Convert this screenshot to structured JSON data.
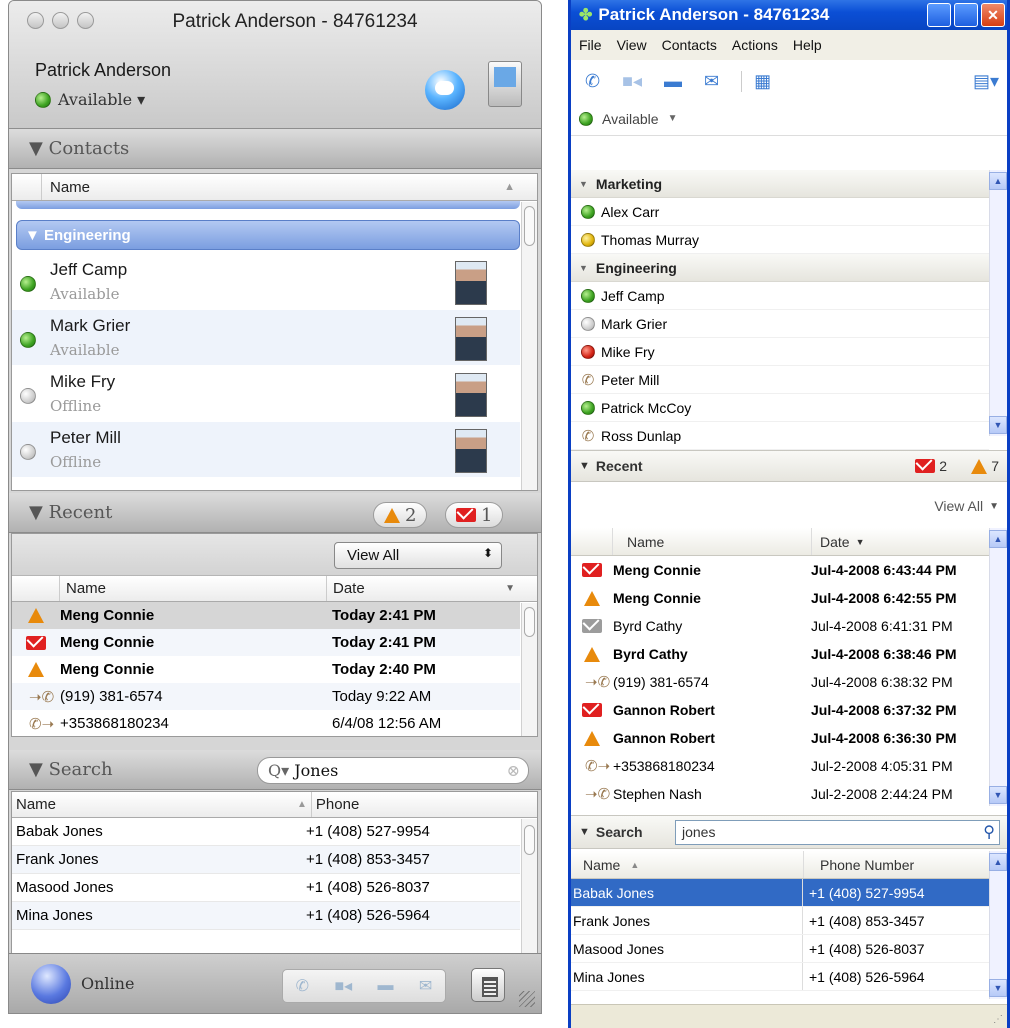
{
  "mac": {
    "title": "Patrick Anderson - 84761234",
    "user": "Patrick Anderson",
    "status": "Available ▾",
    "contacts_header": "▼ Contacts",
    "name_col": "Name",
    "group": "▼ Engineering",
    "contacts": [
      {
        "name": "Jeff Camp",
        "status": "Available",
        "presence": "green"
      },
      {
        "name": "Mark Grier",
        "status": "Available",
        "presence": "green"
      },
      {
        "name": "Mike Fry",
        "status": "Offline",
        "presence": "offline"
      },
      {
        "name": "Peter Mill",
        "status": "Offline",
        "presence": "offline"
      }
    ],
    "recent_header": "▼ Recent",
    "alert_count": "2",
    "msg_count": "1",
    "view_all": "View All",
    "recent_cols": {
      "name": "Name",
      "date": "Date"
    },
    "recent": [
      {
        "icon": "warning-icon",
        "name": "Meng Connie",
        "date": "Today 2:41 PM",
        "bold": true,
        "selected": true
      },
      {
        "icon": "voicemail-icon",
        "name": "Meng Connie",
        "date": "Today 2:41 PM",
        "bold": true
      },
      {
        "icon": "warning-icon",
        "name": "Meng Connie",
        "date": "Today 2:40 PM",
        "bold": true
      },
      {
        "icon": "incoming-call-icon",
        "name": "(919) 381-6574",
        "date": "Today 9:22 AM",
        "bold": false
      },
      {
        "icon": "outgoing-call-icon",
        "name": "+353868180234",
        "date": "6/4/08 12:56 AM",
        "bold": false
      }
    ],
    "search_header": "▼ Search",
    "search_value": "Jones",
    "search_cols": {
      "name": "Name",
      "phone": "Phone"
    },
    "search_results": [
      {
        "name": "Babak Jones",
        "phone": "+1 (408) 527-9954"
      },
      {
        "name": "Frank Jones",
        "phone": "+1 (408) 853-3457"
      },
      {
        "name": "Masood Jones",
        "phone": "+1 (408) 526-8037"
      },
      {
        "name": "Mina Jones",
        "phone": "+1 (408) 526-5964"
      }
    ],
    "online": "Online"
  },
  "xp": {
    "title": "Patrick Anderson - 84761234",
    "menu": [
      "File",
      "View",
      "Contacts",
      "Actions",
      "Help"
    ],
    "status": "Available",
    "groups": [
      {
        "name": "Marketing",
        "members": [
          {
            "name": "Alex Carr",
            "presence": "green"
          },
          {
            "name": "Thomas Murray",
            "presence": "yellow"
          }
        ]
      },
      {
        "name": "Engineering",
        "members": [
          {
            "name": "Jeff Camp",
            "presence": "green"
          },
          {
            "name": "Mark Grier",
            "presence": "offline"
          },
          {
            "name": "Mike Fry",
            "presence": "red"
          },
          {
            "name": "Peter Mill",
            "presence": "phone"
          },
          {
            "name": "Patrick McCoy",
            "presence": "green"
          },
          {
            "name": "Ross Dunlap",
            "presence": "phone"
          }
        ]
      }
    ],
    "recent_header": "Recent",
    "msg_count": "2",
    "alert_count": "7",
    "view_all": "View All",
    "recent_cols": {
      "name": "Name",
      "date": "Date"
    },
    "recent": [
      {
        "icon": "voicemail-icon",
        "name": "Meng Connie",
        "date": "Jul-4-2008 6:43:44 PM",
        "bold": true
      },
      {
        "icon": "warning-icon",
        "name": "Meng Connie",
        "date": "Jul-4-2008 6:42:55 PM",
        "bold": true
      },
      {
        "icon": "voicemail-read-icon",
        "name": "Byrd Cathy",
        "date": "Jul-4-2008 6:41:31 PM",
        "bold": false
      },
      {
        "icon": "warning-icon",
        "name": "Byrd Cathy",
        "date": "Jul-4-2008 6:38:46 PM",
        "bold": true
      },
      {
        "icon": "incoming-call-icon",
        "name": "(919) 381-6574",
        "date": "Jul-4-2008 6:38:32 PM",
        "bold": false
      },
      {
        "icon": "voicemail-icon",
        "name": "Gannon Robert",
        "date": "Jul-4-2008 6:37:32 PM",
        "bold": true
      },
      {
        "icon": "warning-icon",
        "name": "Gannon Robert",
        "date": "Jul-4-2008 6:36:30 PM",
        "bold": true
      },
      {
        "icon": "outgoing-call-icon",
        "name": "+353868180234",
        "date": "Jul-2-2008 4:05:31 PM",
        "bold": false
      },
      {
        "icon": "incoming-call-icon",
        "name": "Stephen Nash",
        "date": "Jul-2-2008 2:44:24 PM",
        "bold": false
      }
    ],
    "search_header": "Search",
    "search_value": "jones",
    "search_cols": {
      "name": "Name",
      "phone": "Phone Number"
    },
    "search_results": [
      {
        "name": "Babak Jones",
        "phone": "+1 (408) 527-9954",
        "selected": true
      },
      {
        "name": "Frank Jones",
        "phone": "+1 (408) 853-3457"
      },
      {
        "name": "Masood Jones",
        "phone": "+1 (408) 526-8037"
      },
      {
        "name": "Mina Jones",
        "phone": "+1 (408) 526-5964"
      }
    ]
  }
}
